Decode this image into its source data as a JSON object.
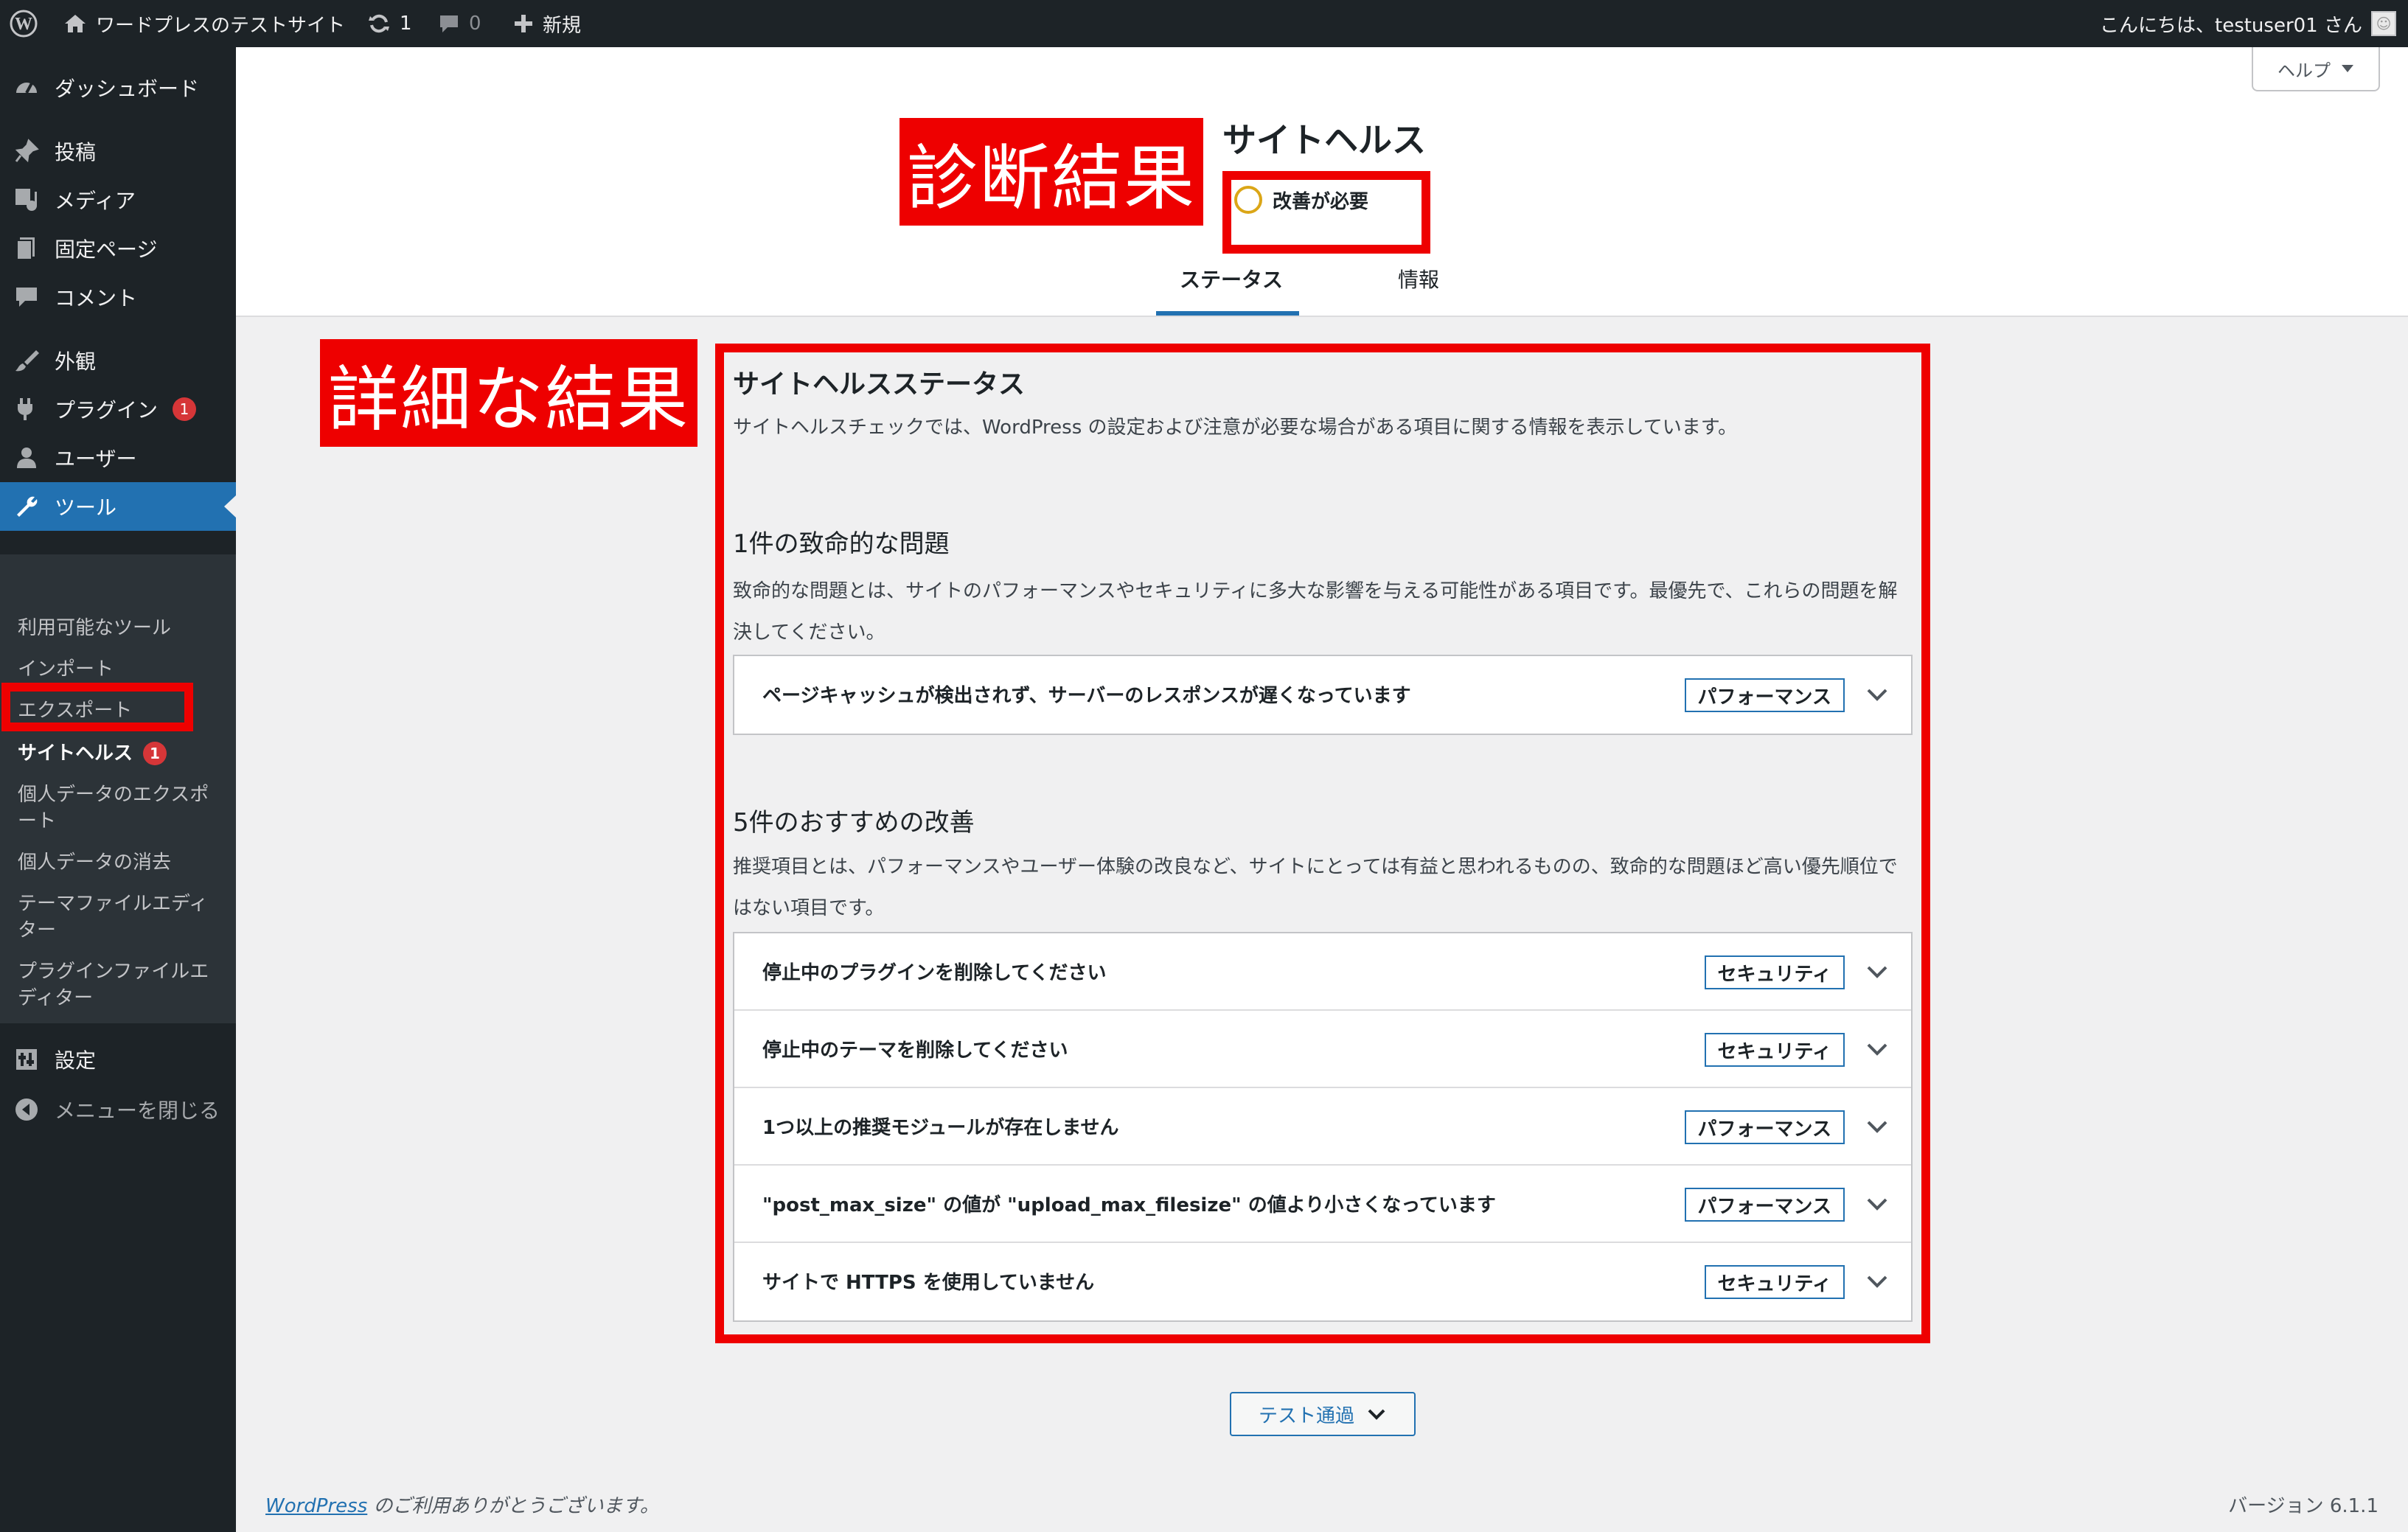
{
  "admin_bar": {
    "site_name": "ワードプレスのテストサイト",
    "updates_count": "1",
    "comments_count": "0",
    "new_label": "新規",
    "greeting": "こんにちは、testuser01 さん"
  },
  "help_tab": {
    "label": "ヘルプ"
  },
  "sidebar": {
    "items": [
      {
        "label": "ダッシュボード",
        "icon": "dashboard-icon"
      },
      {
        "label": "投稿",
        "icon": "pin-icon"
      },
      {
        "label": "メディア",
        "icon": "media-icon"
      },
      {
        "label": "固定ページ",
        "icon": "page-icon"
      },
      {
        "label": "コメント",
        "icon": "comment-icon"
      },
      {
        "label": "外観",
        "icon": "brush-icon"
      },
      {
        "label": "プラグイン",
        "icon": "plugin-icon",
        "badge": "1"
      },
      {
        "label": "ユーザー",
        "icon": "user-icon"
      },
      {
        "label": "ツール",
        "icon": "wrench-icon",
        "active": true
      },
      {
        "label": "設定",
        "icon": "settings-icon"
      },
      {
        "label": "メニューを閉じる",
        "icon": "collapse-icon"
      }
    ],
    "submenu": [
      "利用可能なツール",
      "インポート",
      "エクスポート",
      "サイトヘルス",
      "個人データのエクスポート",
      "個人データの消去",
      "テーマファイルエディター",
      "プラグインファイルエディター"
    ],
    "site_health_badge": "1"
  },
  "header": {
    "title": "サイトヘルス",
    "status": "改善が必要",
    "tabs": [
      "ステータス",
      "情報"
    ]
  },
  "annotations": {
    "diagnosis": "診断結果",
    "detail": "詳細な結果"
  },
  "content": {
    "section_title": "サイトヘルスステータス",
    "section_desc": "サイトヘルスチェックでは、WordPress の設定および注意が必要な場合がある項目に関する情報を表示しています。",
    "critical": {
      "title": "1件の致命的な問題",
      "desc": "致命的な問題とは、サイトのパフォーマンスやセキュリティに多大な影響を与える可能性がある項目です。最優先で、これらの問題を解決してください。",
      "issues": [
        {
          "title": "ページキャッシュが検出されず、サーバーのレスポンスが遅くなっています",
          "badge": "パフォーマンス"
        }
      ]
    },
    "recommended": {
      "title": "5件のおすすめの改善",
      "desc": "推奨項目とは、パフォーマンスやユーザー体験の改良など、サイトにとっては有益と思われるものの、致命的な問題ほど高い優先順位ではない項目です。",
      "issues": [
        {
          "title": "停止中のプラグインを削除してください",
          "badge": "セキュリティ"
        },
        {
          "title": "停止中のテーマを削除してください",
          "badge": "セキュリティ"
        },
        {
          "title": "1つ以上の推奨モジュールが存在しません",
          "badge": "パフォーマンス"
        },
        {
          "title": "\"post_max_size\" の値が \"upload_max_filesize\" の値より小さくなっています",
          "badge": "パフォーマンス"
        },
        {
          "title": "サイトで HTTPS を使用していません",
          "badge": "セキュリティ"
        }
      ]
    },
    "passed_button": "テスト通過"
  },
  "footer": {
    "link": "WordPress",
    "thanks": " のご利用ありがとうございます。",
    "version": "バージョン 6.1.1"
  },
  "colors": {
    "admin_dark": "#1d2327",
    "accent": "#2271b1",
    "annotation_red": "#ee0000",
    "warning_ring": "#dba617"
  }
}
